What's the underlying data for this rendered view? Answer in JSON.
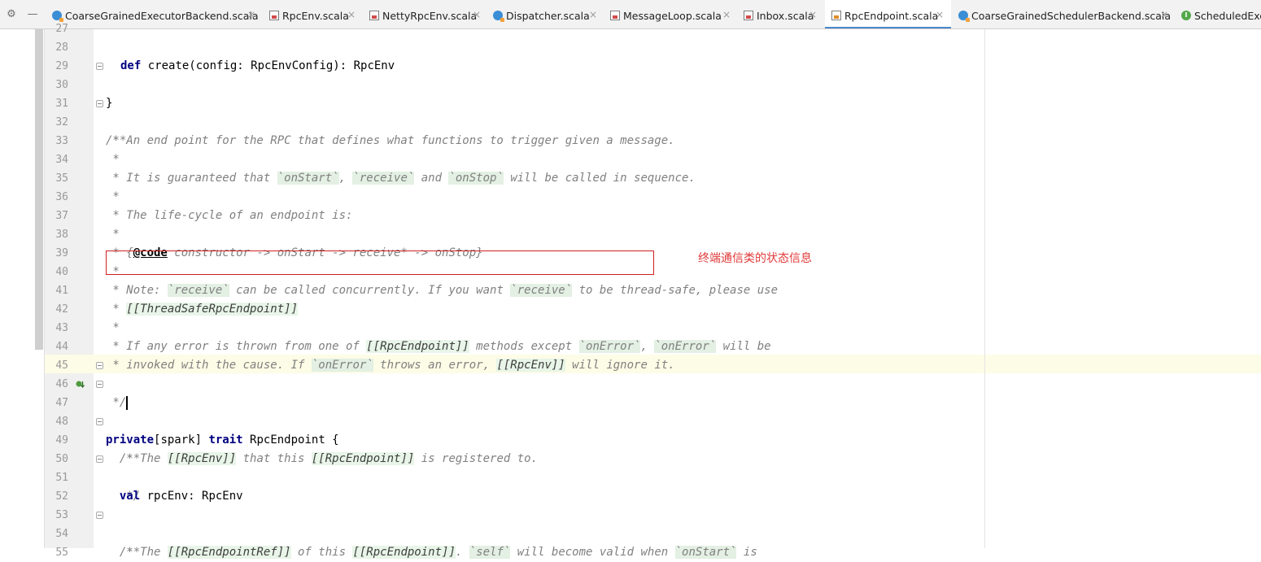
{
  "tabs": [
    {
      "label": "CoarseGrainedExecutorBackend.scala",
      "icon": "scala-object-icon",
      "active": false
    },
    {
      "label": "RpcEnv.scala",
      "icon": "scala-file-icon",
      "active": false
    },
    {
      "label": "NettyRpcEnv.scala",
      "icon": "scala-file-icon",
      "active": false
    },
    {
      "label": "Dispatcher.scala",
      "icon": "scala-object-icon",
      "active": false
    },
    {
      "label": "MessageLoop.scala",
      "icon": "scala-file-icon",
      "active": false
    },
    {
      "label": "Inbox.scala",
      "icon": "scala-file-icon",
      "active": false
    },
    {
      "label": "RpcEndpoint.scala",
      "icon": "scala-file-icon",
      "active": true
    },
    {
      "label": "CoarseGrainedSchedulerBackend.scala",
      "icon": "scala-object-icon",
      "active": false
    },
    {
      "label": "ScheduledExe",
      "icon": "scala-trait-icon",
      "active": false
    }
  ],
  "tab_close_glyph": "×",
  "toolbar": {
    "settings_icon": "gear-icon",
    "hide_icon": "minus-icon"
  },
  "editor": {
    "current_line": 45,
    "lines": [
      {
        "n": "27"
      },
      {
        "n": "28"
      },
      {
        "n": "29"
      },
      {
        "n": "30"
      },
      {
        "n": "31"
      },
      {
        "n": "32"
      },
      {
        "n": "33"
      },
      {
        "n": "34"
      },
      {
        "n": "35"
      },
      {
        "n": "36"
      },
      {
        "n": "37"
      },
      {
        "n": "38"
      },
      {
        "n": "39"
      },
      {
        "n": "40"
      },
      {
        "n": "41"
      },
      {
        "n": "42"
      },
      {
        "n": "43"
      },
      {
        "n": "44"
      },
      {
        "n": "45"
      },
      {
        "n": "46"
      },
      {
        "n": "47"
      },
      {
        "n": "48"
      },
      {
        "n": "49"
      },
      {
        "n": "50"
      },
      {
        "n": "51"
      },
      {
        "n": "52"
      },
      {
        "n": "53"
      },
      {
        "n": "54"
      },
      {
        "n": "55"
      }
    ],
    "code": {
      "l28_kw": "def",
      "l28_rest": " create(config: RpcEnvConfig): RpcEnv",
      "l29": "}",
      "l31": "/**",
      "l32": " * An end point for the RPC that defines what functions to trigger given a message.",
      "l33": " *",
      "l34_a": " * It is guaranteed that ",
      "l34_b": "`onStart`",
      "l34_c": ", ",
      "l34_d": "`receive`",
      "l34_e": " and ",
      "l34_f": "`onStop`",
      "l34_g": " will be called in sequence.",
      "l35": " *",
      "l36": " * The life-cycle of an endpoint is:",
      "l37": " *",
      "l38_a": " * {",
      "l38_tag": "@code",
      "l38_b": " constructor -> onStart -> receive* -> onStop}",
      "l39": " *",
      "l40_a": " * Note: ",
      "l40_b": "`receive`",
      "l40_c": " can be called concurrently. If you want ",
      "l40_d": "`receive`",
      "l40_e": " to be thread-safe, please use",
      "l41_a": " * ",
      "l41_b": "[[ThreadSafeRpcEndpoint]]",
      "l42": " *",
      "l43_a": " * If any error is thrown from one of ",
      "l43_b": "[[RpcEndpoint]]",
      "l43_c": " methods except ",
      "l43_d": "`onError`",
      "l43_e": ", ",
      "l43_f": "`onError`",
      "l43_g": " will be",
      "l44_a": " * invoked with the cause. If ",
      "l44_b": "`onError`",
      "l44_c": " throws an error, ",
      "l44_d": "[[RpcEnv]]",
      "l44_e": " will ignore it.",
      "l45": " */",
      "l46_kw": "private",
      "l46_b": "[spark] ",
      "l46_kw2": "trait",
      "l46_c": " RpcEndpoint {",
      "l48": "  /**",
      "l49_a": "   * The ",
      "l49_b": "[[RpcEnv]]",
      "l49_c": " that this ",
      "l49_d": "[[RpcEndpoint]]",
      "l49_e": " is registered to.",
      "l50": "   */",
      "l51_kw": "  val",
      "l51_rest": " rpcEnv: RpcEnv",
      "l53": "  /**",
      "l54_a": "   * The ",
      "l54_b": "[[RpcEndpointRef]]",
      "l54_c": " of this ",
      "l54_d": "[[RpcEndpoint]]",
      "l54_e": ". ",
      "l54_f": "`self`",
      "l54_g": " will become valid when ",
      "l54_h": "`onStart`",
      "l54_i": " is"
    }
  },
  "annotation": {
    "text": "终端通信类的状态信息",
    "color": "#e03a3a"
  },
  "colors": {
    "keyword": "#000080",
    "comment": "#808080",
    "active_tab_underline": "#4a88c7",
    "annotation_box": "#d02020"
  }
}
